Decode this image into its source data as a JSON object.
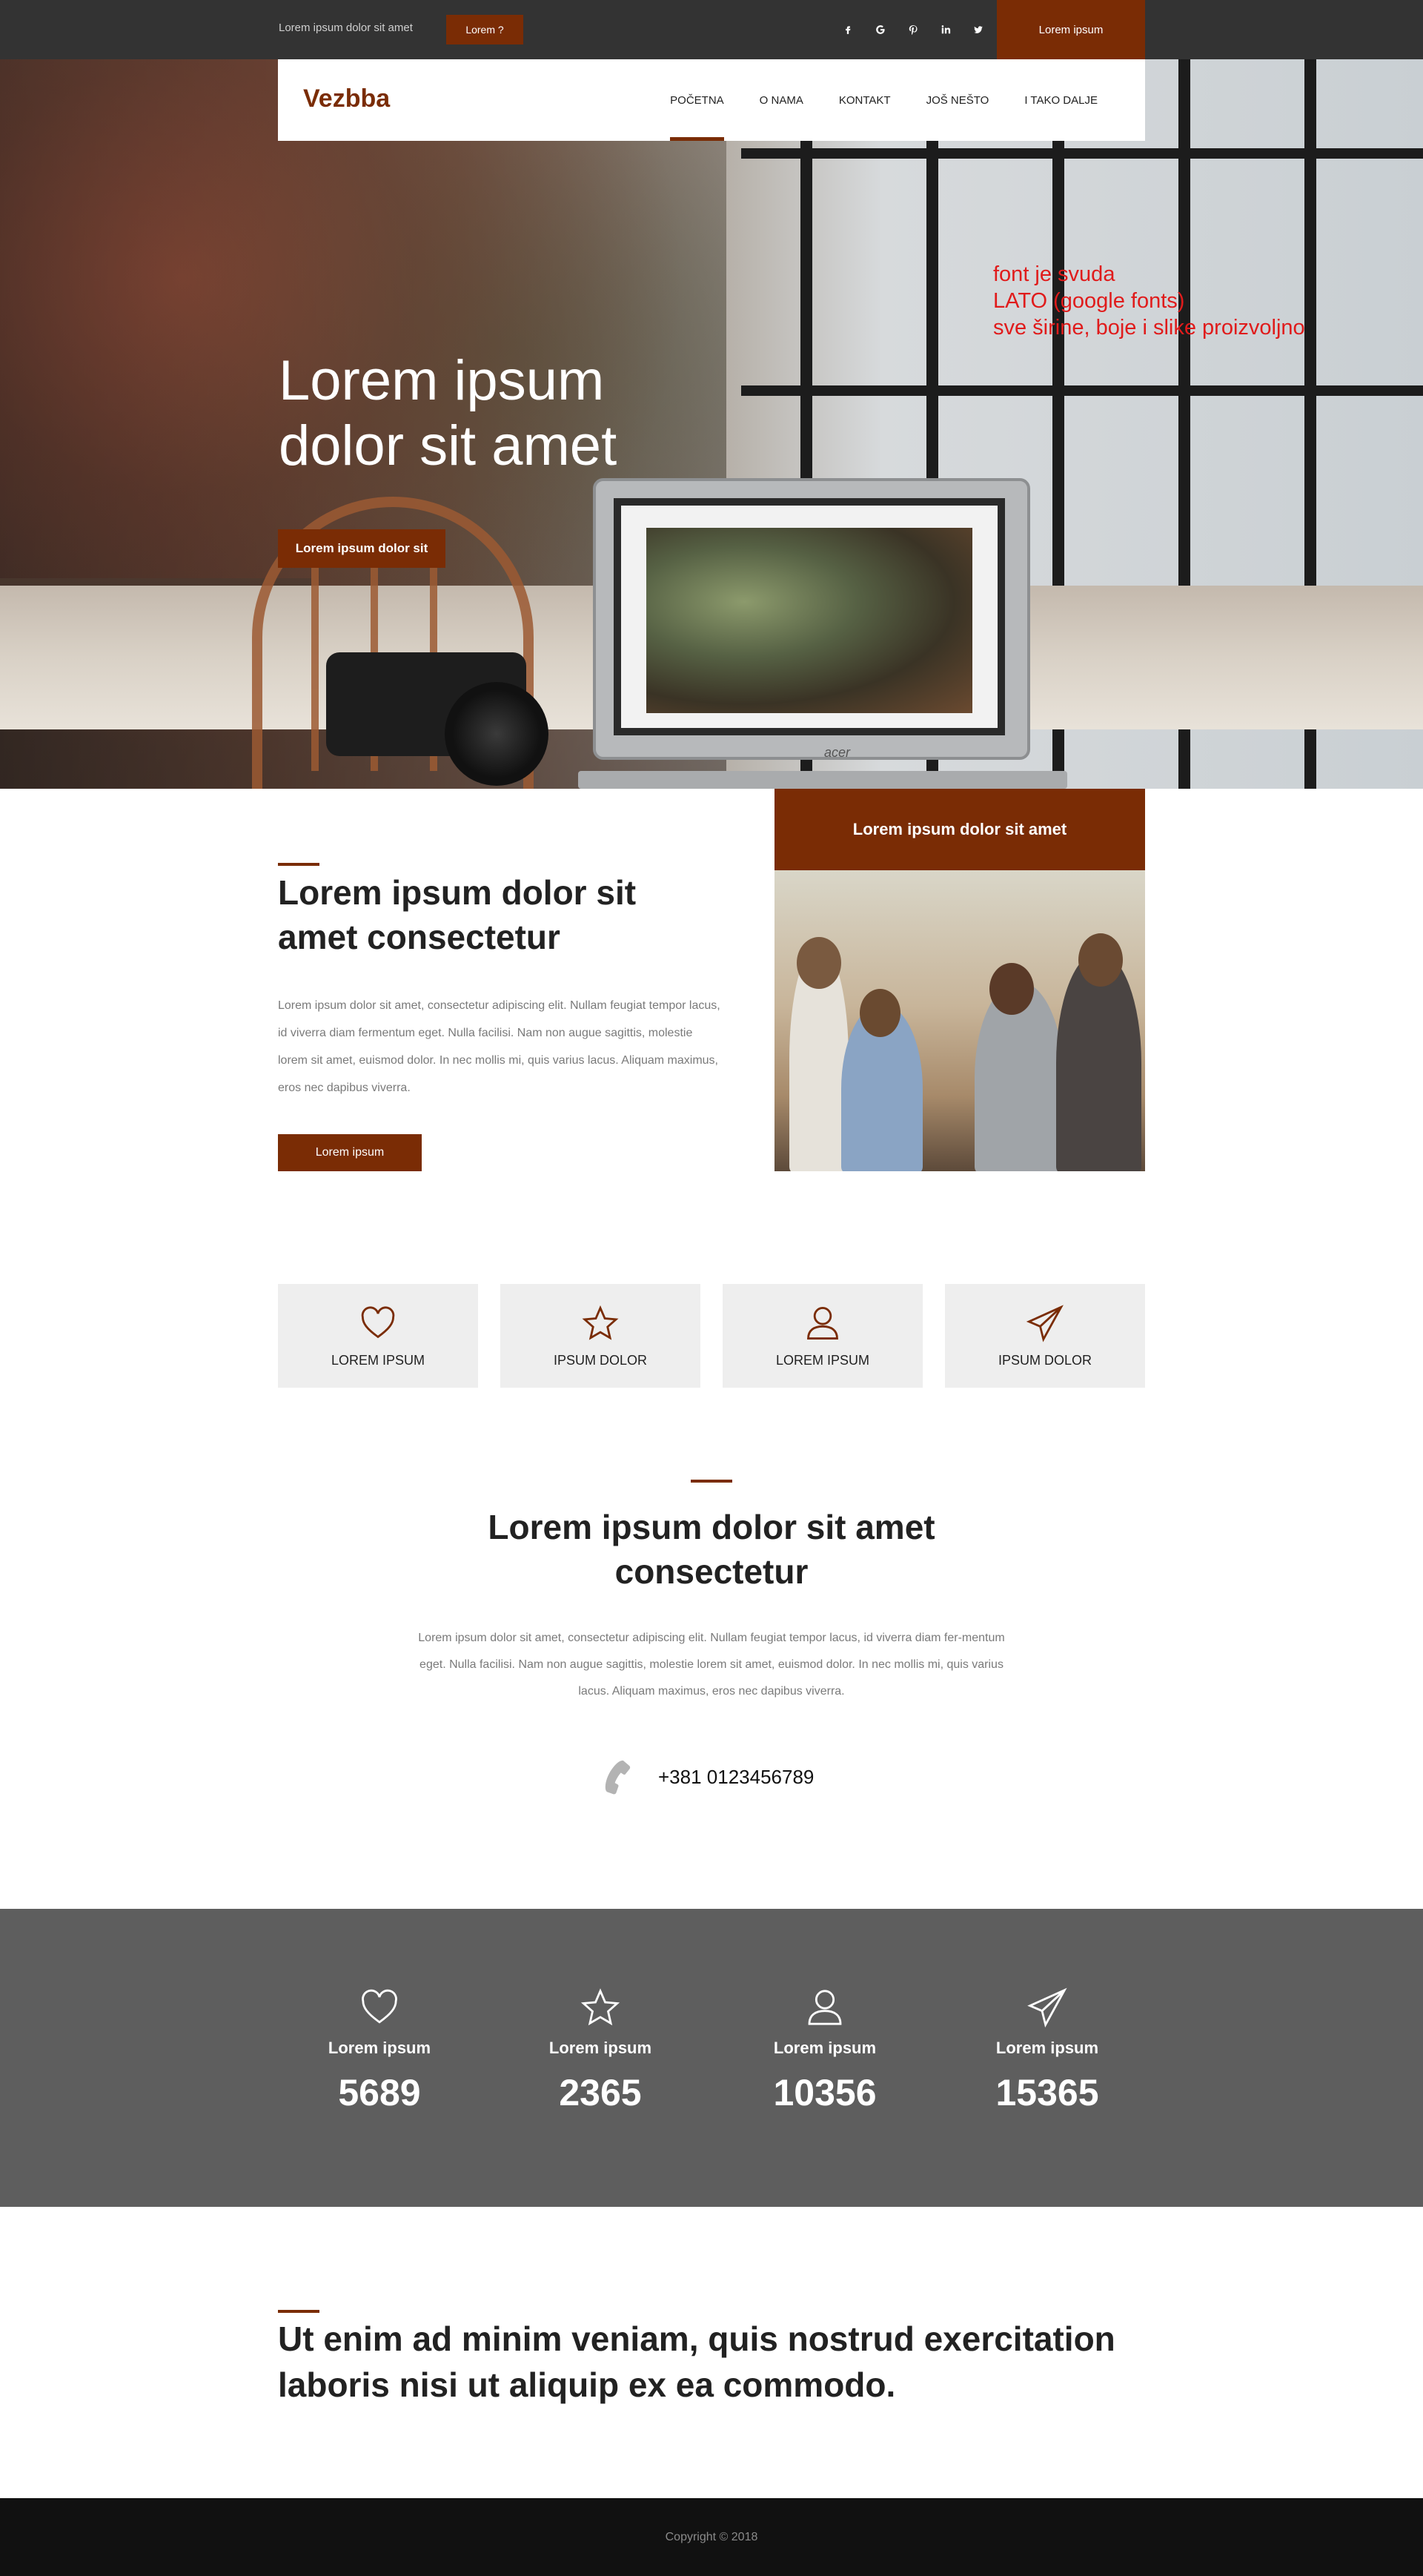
{
  "topbar": {
    "text": "Lorem ipsum dolor sit amet",
    "button": "Lorem ?",
    "socials": [
      "facebook-icon",
      "google-icon",
      "pinterest-icon",
      "linkedin-icon",
      "twitter-icon"
    ],
    "cta": "Lorem ipsum"
  },
  "nav": {
    "logo": "Vezbba",
    "items": [
      {
        "label": "POČETNA",
        "active": true
      },
      {
        "label": "O NAMA",
        "active": false
      },
      {
        "label": "KONTAKT",
        "active": false
      },
      {
        "label": "JOŠ NEŠTO",
        "active": false
      },
      {
        "label": "I TAKO DALJE",
        "active": false
      }
    ]
  },
  "hero": {
    "title_line1": "Lorem ipsum",
    "title_line2": "dolor sit amet",
    "button": "Lorem ipsum dolor sit",
    "laptop_brand": "acer",
    "note_line1": "font je svuda",
    "note_line2": "LATO (google fonts)",
    "note_line3": "sve širine, boje i slike proizvoljno"
  },
  "about": {
    "title": "Lorem ipsum dolor sit amet consectetur",
    "text": "Lorem ipsum dolor sit amet, consectetur adipiscing elit. Nullam feugiat tempor lacus, id viverra diam fermentum eget. Nulla facilisi. Nam non augue sagittis, molestie lorem sit amet, euismod dolor. In nec mollis mi, quis varius lacus. Aliquam maximus, eros nec dapibus viverra.",
    "button": "Lorem ipsum",
    "card_title": "Lorem ipsum dolor sit amet"
  },
  "features": [
    {
      "icon": "heart-icon",
      "label": "LOREM IPSUM"
    },
    {
      "icon": "star-icon",
      "label": "IPSUM DOLOR"
    },
    {
      "icon": "user-icon",
      "label": "LOREM IPSUM"
    },
    {
      "icon": "paper-plane-icon",
      "label": "IPSUM DOLOR"
    }
  ],
  "center": {
    "title": "Lorem ipsum dolor sit amet consectetur",
    "text": "Lorem ipsum dolor sit amet, consectetur adipiscing elit. Nullam feugiat tempor lacus, id viverra diam fer-mentum eget. Nulla facilisi. Nam non augue sagittis, molestie lorem sit amet, euismod dolor. In nec mollis mi, quis varius lacus. Aliquam maximus, eros nec dapibus viverra.",
    "phone": "+381 0123456789"
  },
  "stats": [
    {
      "icon": "heart-icon",
      "label": "Lorem ipsum",
      "value": "5689"
    },
    {
      "icon": "star-icon",
      "label": "Lorem ipsum",
      "value": "2365"
    },
    {
      "icon": "user-icon",
      "label": "Lorem ipsum",
      "value": "10356"
    },
    {
      "icon": "paper-plane-icon",
      "label": "Lorem ipsum",
      "value": "15365"
    }
  ],
  "quote": "Ut enim ad minim veniam, quis nostrud exercitation laboris nisi ut aliquip ex ea commodo.",
  "footer": {
    "copyright": "Copyright © 2018"
  },
  "colors": {
    "accent": "#7a2c05",
    "topbar": "#333333",
    "stats_bg": "#5e5e5e",
    "footer_bg": "#111111",
    "note": "#e01b1b"
  }
}
